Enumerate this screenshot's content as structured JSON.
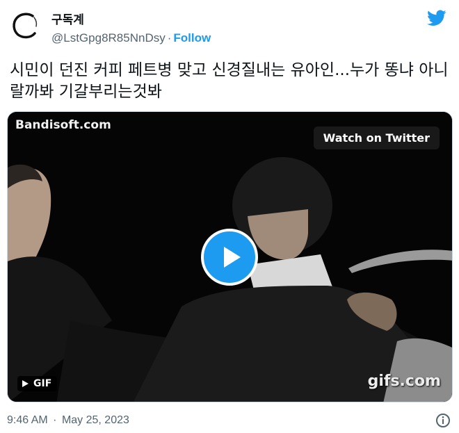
{
  "author": {
    "display_name": "구독계",
    "handle": "@LstGpg8R85NnDsy",
    "separator": "·",
    "follow_label": "Follow",
    "avatar_icon": "circle-brush-avatar"
  },
  "brand": {
    "logo_icon": "twitter-bird-icon",
    "color": "#1d9bf0"
  },
  "tweet": {
    "text": "시민이 던진 커피 페트병 맞고 신경질내는 유아인...누가 똥냐 아니랄까봐 기갈부리는것봐"
  },
  "media": {
    "watermark_top": "Bandisoft.com",
    "watch_label": "Watch on Twitter",
    "play_icon": "play-icon",
    "gif_label": "GIF",
    "watermark_bottom": "gifs.com"
  },
  "footer": {
    "time": "9:46 AM",
    "separator": "·",
    "date": "May 25, 2023",
    "info_icon": "info-icon"
  }
}
